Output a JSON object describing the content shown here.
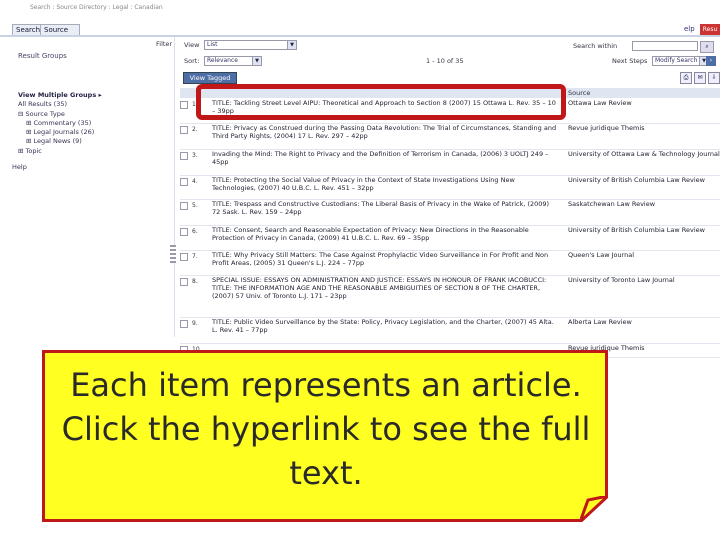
{
  "topbar": {
    "crumb": "Search : Source Directory : Legal : Canadian",
    "tabs": [
      "Search",
      "Source Directory"
    ],
    "right_links": [
      "elp"
    ],
    "result_tab": "Resu"
  },
  "left_panel": {
    "heading": "Result Groups",
    "view_multiple": "View Multiple Groups ▸",
    "all_results": "All Results (35)",
    "source_type": "⊟ Source Type",
    "items": [
      "⊞ Commentary (35)",
      "⊞ Legal Journals (26)",
      "⊞ Legal News (9)"
    ],
    "topic": "⊞ Topic",
    "help": "Help"
  },
  "toolbar": {
    "filter_label": "Filter",
    "view_label": "View",
    "view_value": "List",
    "sort_label": "Sort:",
    "sort_value": "Relevance",
    "range": "1 - 10 of 35",
    "search_within_label": "Search within",
    "next_steps_label": "Next Steps",
    "next_steps_value": "Modify Search",
    "view_tagged": "View Tagged"
  },
  "table": {
    "source_header": "Source",
    "rows": [
      {
        "num": "1.",
        "title": "TITLE: Tackling Street Level AIPU: Theoretical and Approach to Section 8 (2007) 15 Ottawa L. Rev. 35 – 10 – 39pp",
        "source": "Ottawa Law Review"
      },
      {
        "num": "2.",
        "title": "TITLE: Privacy as Construed during the Passing Data Revolution: The Trial of Circumstances, Standing and Third Party Rights, (2004) 17 L. Rev. 297 – 42pp",
        "source": "Revue juridique Themis"
      },
      {
        "num": "3.",
        "title": "Invading the Mind: The Right to Privacy and the Definition of Terrorism in Canada, (2006) 3 UOLTJ 249 – 45pp",
        "source": "University of Ottawa Law & Technology Journal"
      },
      {
        "num": "4.",
        "title": "TITLE: Protecting the Social Value of Privacy in the Context of State Investigations Using New Technologies, (2007) 40 U.B.C. L. Rev. 451 – 32pp",
        "source": "University of British Columbia Law Review"
      },
      {
        "num": "5.",
        "title": "TITLE: Trespass and Constructive Custodians: The Liberal Basis of Privacy in the Wake of Patrick, (2009) 72 Sask. L. Rev. 159 – 24pp",
        "source": "Saskatchewan Law Review"
      },
      {
        "num": "6.",
        "title": "TITLE: Consent, Search and Reasonable Expectation of Privacy: New Directions in the Reasonable Protection of Privacy in Canada, (2009) 41 U.B.C. L. Rev. 69 – 35pp",
        "source": "University of British Columbia Law Review"
      },
      {
        "num": "7.",
        "title": "TITLE: Why Privacy Still Matters: The Case Against Prophylactic Video Surveillance in For Profit and Non Profit Areas, (2005) 31 Queen's L.J. 224 – 77pp",
        "source": "Queen's Law Journal"
      },
      {
        "num": "8.",
        "title": "SPECIAL ISSUE: ESSAYS ON ADMINISTRATION AND JUSTICE: ESSAYS IN HONOUR OF FRANK IACOBUCCI: TITLE: THE INFORMATION AGE AND THE REASONABLE AMBIGUITIES OF SECTION 8 OF THE CHARTER, (2007) 57 Univ. of Toronto L.J. 171 – 23pp",
        "source": "University of Toronto Law Journal"
      },
      {
        "num": "9.",
        "title": "TITLE: Public Video Surveillance by the State: Policy, Privacy Legislation, and the Charter, (2007) 45 Alta. L. Rev. 41 – 77pp",
        "source": "Alberta Law Review"
      },
      {
        "num": "10.",
        "title": "",
        "source": "Revue juridique Themis"
      }
    ]
  },
  "callout": {
    "text": "Each item represents an article. Click the hyperlink to see the full text.",
    "border_color": "#c01818",
    "fill_color": "#ffff22"
  }
}
